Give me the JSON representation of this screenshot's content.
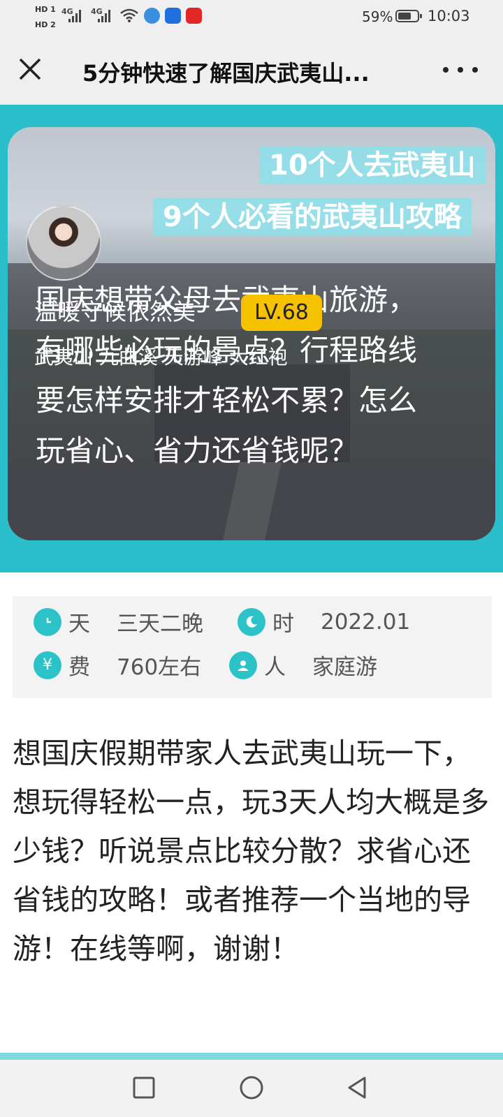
{
  "status_bar": {
    "hd1": "HD 1",
    "hd2": "HD 2",
    "signal1": "4G",
    "signal2": "4G",
    "icons": [
      "wifi-icon",
      "browser-app-icon",
      "lightbulb-app-icon",
      "video-app-icon"
    ],
    "battery_percent": "59%",
    "battery_level": 0.59,
    "time": "10:03"
  },
  "header": {
    "title": "5分钟快速了解国庆武夷山...",
    "close_icon": "close-icon",
    "more_icon": "more-dots-icon"
  },
  "hero": {
    "banner_line1": "10个人去武夷山",
    "banner_line2": "9个人必看的武夷山攻略",
    "title": "国庆想带父母去武夷山旅游，有哪些必玩的景点？行程路线要怎样安排才轻松不累？怎么玩省心、省力还省钱呢？",
    "author_name": "温暖守候依然美",
    "author_tags": "武夷山 九曲溪 天游峰 大红袍",
    "level": "LV.68",
    "colors": {
      "band": "#29bec9",
      "badge": "#f6c200"
    }
  },
  "trip_info": {
    "days_label": "天",
    "days_value": "三天二晚",
    "time_label": "时",
    "time_value": "2022.01",
    "cost_label": "费",
    "cost_value": "760左右",
    "people_label": "人",
    "people_value": "家庭游",
    "icon_color": "#2bc3c8"
  },
  "body": {
    "text": "想国庆假期带家人去武夷山玩一下，想玩得轻松一点，玩3天人均大概是多少钱？听说景点比较分散？求省心还省钱的攻略！或者推荐一个当地的导游！在线等啊，谢谢！"
  },
  "nav_bar": {
    "icons": [
      "recent-apps-icon",
      "home-icon",
      "back-icon"
    ]
  }
}
